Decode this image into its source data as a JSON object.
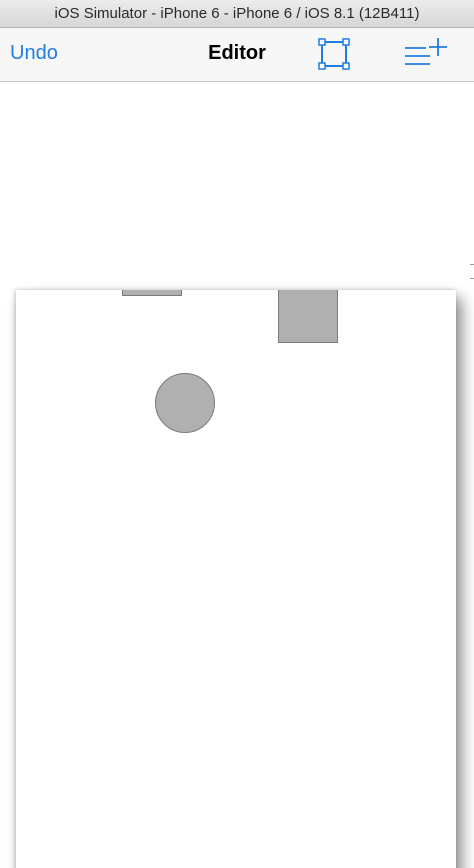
{
  "window": {
    "title": "iOS Simulator - iPhone 6 - iPhone 6 / iOS 8.1 (12B411)"
  },
  "navbar": {
    "undo_label": "Undo",
    "title": "Editor",
    "frame_icon": "bounding-box-icon",
    "add_icon": "add-list-icon"
  },
  "colors": {
    "tint": "#1f7ee0",
    "shape_fill": "#b0b0b0",
    "shape_stroke": "#7a7a7a"
  },
  "canvas": {
    "shapes": [
      {
        "kind": "rectangle"
      },
      {
        "kind": "rectangle"
      },
      {
        "kind": "circle"
      }
    ]
  }
}
